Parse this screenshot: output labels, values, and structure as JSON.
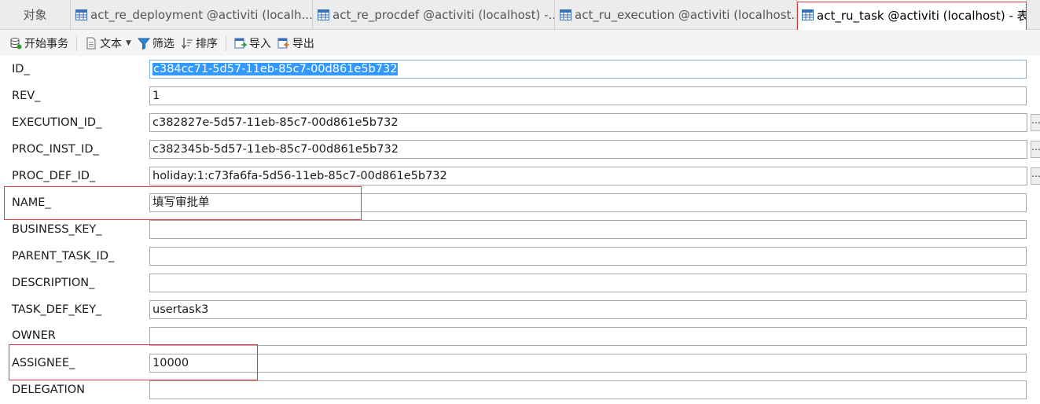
{
  "tabs": [
    {
      "label": "对象",
      "icon": "none"
    },
    {
      "label": "act_re_deployment @activiti (localh...",
      "icon": "table-icon"
    },
    {
      "label": "act_re_procdef @activiti (localhost) -...",
      "icon": "table-icon"
    },
    {
      "label": "act_ru_execution @activiti (localhost...",
      "icon": "table-icon"
    },
    {
      "label": "act_ru_task @activiti (localhost) - 表",
      "icon": "table-icon",
      "active": true
    }
  ],
  "toolbar": {
    "begin_transaction": "开始事务",
    "text": "文本",
    "filter": "筛选",
    "sort": "排序",
    "import": "导入",
    "export": "导出"
  },
  "colors": {
    "highlight": "#e03b3b",
    "selection": "#3399ff"
  },
  "fields": [
    {
      "label": "ID_",
      "value": "c384cc71-5d57-11eb-85c7-00d861e5b732",
      "selected": true
    },
    {
      "label": "REV_",
      "value": "1"
    },
    {
      "label": "EXECUTION_ID_",
      "value": "c382827e-5d57-11eb-85c7-00d861e5b732",
      "lookup": "..."
    },
    {
      "label": "PROC_INST_ID_",
      "value": "c382345b-5d57-11eb-85c7-00d861e5b732",
      "lookup": "..."
    },
    {
      "label": "PROC_DEF_ID_",
      "value": "holiday:1:c73fa6fa-5d56-11eb-85c7-00d861e5b732",
      "lookup": "..."
    },
    {
      "label": "NAME_",
      "value": "填写审批单",
      "highlighted": true
    },
    {
      "label": "BUSINESS_KEY_",
      "value": ""
    },
    {
      "label": "PARENT_TASK_ID_",
      "value": ""
    },
    {
      "label": "DESCRIPTION_",
      "value": ""
    },
    {
      "label": "TASK_DEF_KEY_",
      "value": "usertask3"
    },
    {
      "label": "OWNER",
      "value": ""
    },
    {
      "label": "ASSIGNEE_",
      "value": "10000",
      "highlighted": true
    },
    {
      "label": "DELEGATION",
      "value": ""
    }
  ]
}
